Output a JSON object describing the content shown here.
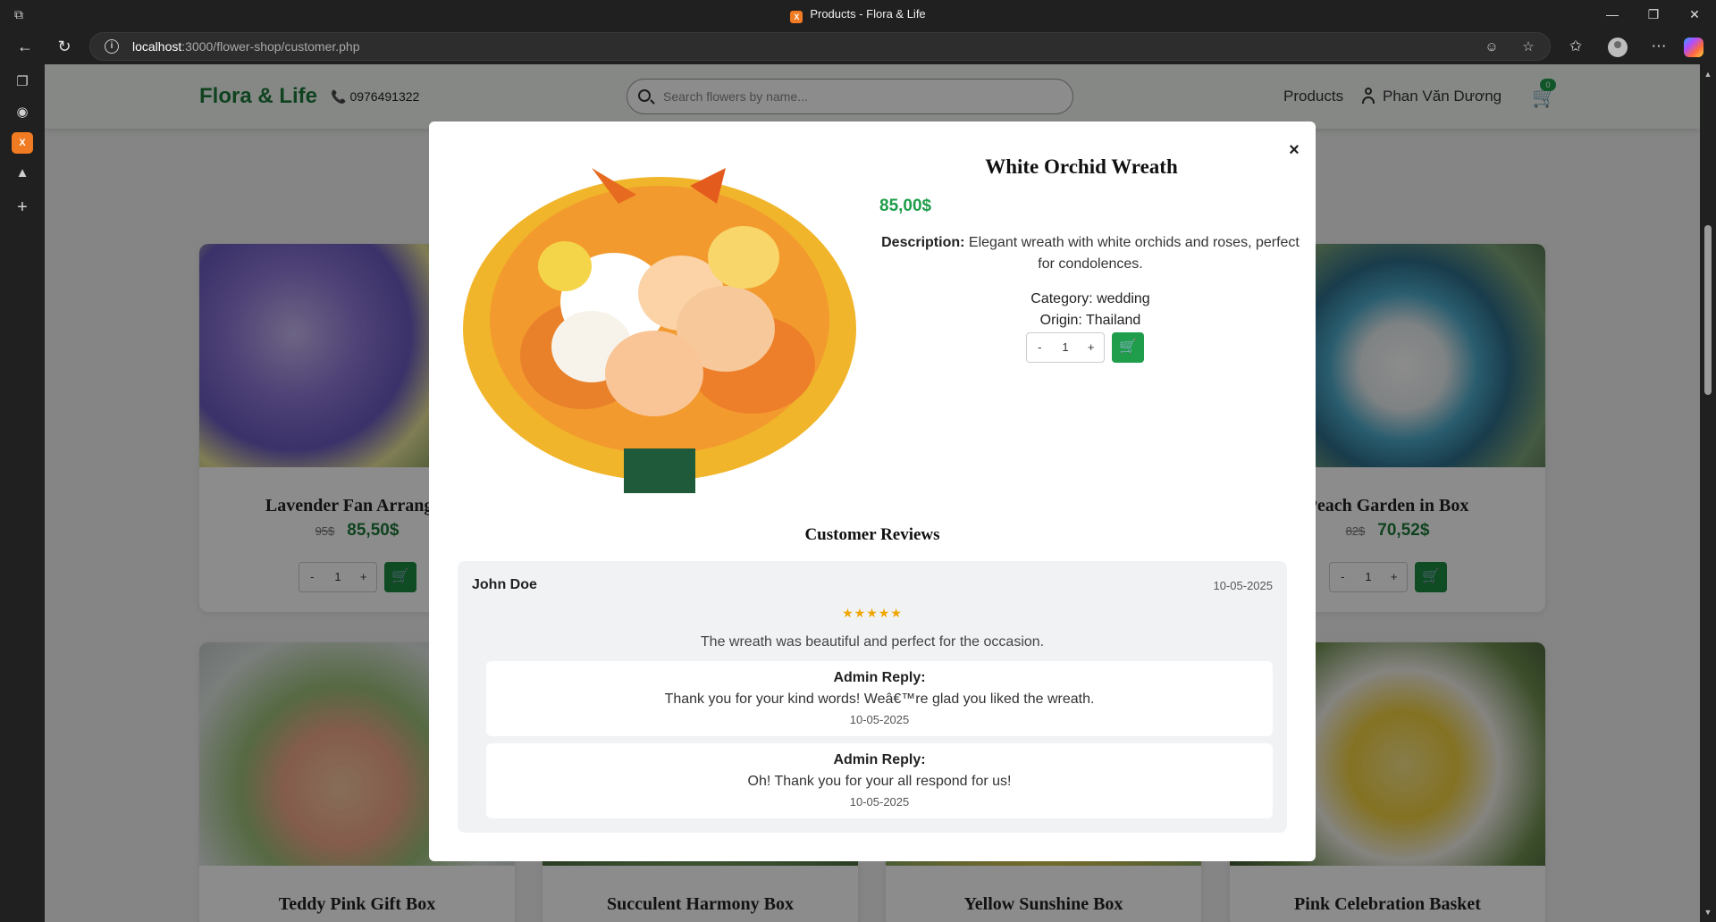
{
  "browser": {
    "tab_title": "Products - Flora & Life",
    "url_host": "localhost",
    "url_rest": ":3000/flower-shop/customer.php"
  },
  "header": {
    "brand": "Flora & Life",
    "phone": "0976491322",
    "search_placeholder": "Search flowers by name...",
    "nav_products": "Products",
    "user_name": "Phan Văn Dương",
    "cart_count": "0"
  },
  "products": [
    {
      "name": "Lavender Fan Arranger",
      "old_price": "95$",
      "price": "85,50$",
      "qty": "1"
    },
    {
      "name": "Peach Garden in Box",
      "old_price": "82$",
      "price": "70,52$",
      "qty": "1"
    },
    {
      "name": "Teddy Pink Gift Box"
    },
    {
      "name": "Succulent Harmony Box"
    },
    {
      "name": "Yellow Sunshine Box"
    },
    {
      "name": "Pink Celebration Basket"
    }
  ],
  "modal": {
    "title": "White Orchid Wreath",
    "price": "85,00$",
    "description_label": "Description:",
    "description": "Elegant wreath with white orchids and roses, perfect for condolences.",
    "category": "Category: wedding",
    "origin": "Origin: Thailand",
    "qty_minus": "-",
    "qty_value": "1",
    "qty_plus": "+",
    "close": "×"
  },
  "reviews": {
    "title": "Customer Reviews",
    "items": [
      {
        "author": "John Doe",
        "date": "10-05-2025",
        "stars": "★★★★★",
        "rating": 5,
        "text": "The wreath was beautiful and perfect for the occasion.",
        "replies": [
          {
            "label": "Admin Reply:",
            "text": "Thank you for your kind words! Weâ€™re glad you liked the wreath.",
            "date": "10-05-2025"
          },
          {
            "label": "Admin Reply:",
            "text": "Oh! Thank you for your all respond for us!",
            "date": "10-05-2025"
          }
        ]
      }
    ]
  },
  "colors": {
    "brand_green": "#1d7a3a",
    "accent_green": "#1f9d4a",
    "star": "#f0a500"
  }
}
